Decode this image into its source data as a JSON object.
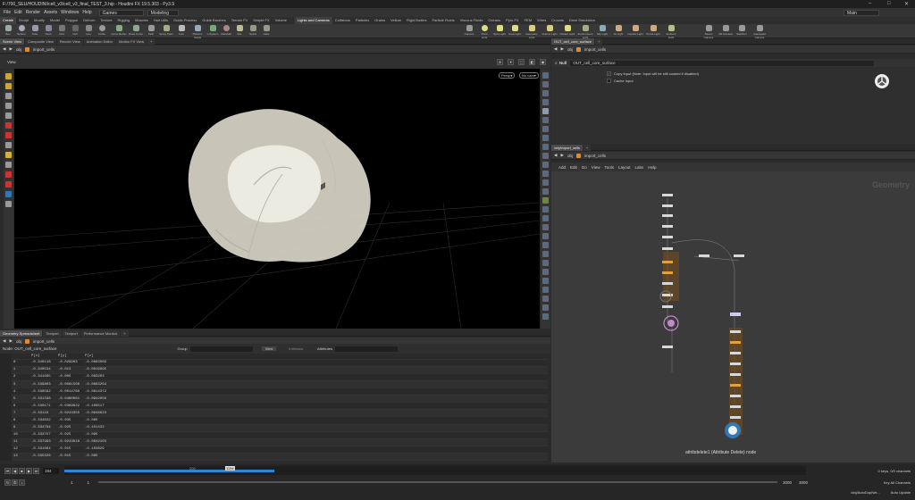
{
  "titlebar": {
    "text": "F:/700_SEU/HOUDINI/cell_v3/cell_v3_final_TEST_3.hip - Houdini FX 19.5.303 - Py3.9",
    "min": "–",
    "max": "□",
    "close": "✕"
  },
  "menubar": {
    "items": [
      "File",
      "Edit",
      "Render",
      "Assets",
      "Windows",
      "Help"
    ],
    "desktop": "Games",
    "mode": "Modeling",
    "main": "Main"
  },
  "shelf_left_tabs": [
    "Create",
    "Sculpt",
    "Modify",
    "Model",
    "Polygon",
    "Deform",
    "Texture",
    "Rigging",
    "Muscles",
    "Hair Utils",
    "Guide Process",
    "Guide Brushes",
    "Terrain FX",
    "Simple FX",
    "Volume"
  ],
  "shelf_right_tabs": [
    "Lights and Cameras",
    "Collisions",
    "Particles",
    "Grains",
    "Vellum",
    "Rigid Bodies",
    "Particle Fluids",
    "Viscous Fluids",
    "Oceans",
    "Pyro FX",
    "FEM",
    "Wires",
    "Crowds",
    "Drive Simulation"
  ],
  "left_tools": [
    "Box",
    "Sphere",
    "Tube",
    "Torus",
    "Grid",
    "Null",
    "Line",
    "Circle",
    "Curve Bezier",
    "Draw Curve",
    "Path",
    "Spray Paint",
    "Font",
    "Platonic Solids",
    "L-System",
    "Metaball",
    "File",
    "Spiral",
    "Helix"
  ],
  "right_tools": [
    "Camera",
    "Point Light",
    "Spot Light",
    "Area Light",
    "Geometry Light",
    "Volume Light",
    "Distant Light",
    "Environment Light",
    "Sky Light",
    "GI Light",
    "Caustic Light",
    "Portal Light",
    "Ambient Light",
    "Stereo Camera",
    "VR Camera",
    "Switcher",
    "Gamepad Camera"
  ],
  "left_tabs": [
    "Scene View",
    "Composite View",
    "Render View",
    "Animation Editor",
    "Motion FX View"
  ],
  "path": {
    "obj": "obj",
    "node": "import_cells"
  },
  "viewport": {
    "label": "View",
    "persp": "Persp▾",
    "cam": "No cam▾"
  },
  "param_tabs": [
    "OUT_cell_core_surface"
  ],
  "params": {
    "node_type": "Null",
    "node_name": "OUT_cell_core_surface",
    "opt1": "Copy Input (Note: Input will be still cooked if disabled)",
    "opt2": "Cache Input"
  },
  "net_tabs": [
    "/obj/import_cells"
  ],
  "net_menu": [
    "Add",
    "Edit",
    "Go",
    "View",
    "Tools",
    "Layout",
    "Labs",
    "Help"
  ],
  "net": {
    "context": "Geometry",
    "status": "attribdelete1 (Attribute Delete) node"
  },
  "bottom_tabs": [
    "Geometry Spreadsheet",
    "Textport",
    "Textport",
    "Performance Monitor"
  ],
  "sheet": {
    "node_label": "Node: OUT_cell_core_surface",
    "group": "Group",
    "view": "View",
    "intrinsics": "Intrinsics",
    "attributes": "Attributes",
    "headers": [
      "",
      "P[x]",
      "P[y]",
      "P[z]"
    ],
    "rows": [
      [
        "0",
        "-0.340118",
        "-0.029903",
        "-0.0683069"
      ],
      [
        "1",
        "-0.340534",
        "-0.013",
        "-0.0819995"
      ],
      [
        "2",
        "-0.341095",
        "-0.005",
        "-0.083203"
      ],
      [
        "3",
        "-0.339803",
        "-0.0081506",
        "-0.0663264"
      ],
      [
        "4",
        "-0.338592",
        "-0.0014768",
        "-0.0814372"
      ],
      [
        "5",
        "-0.331338",
        "-0.0460061",
        "-0.0942056"
      ],
      [
        "6",
        "-0.330171",
        "-0.0369922",
        "-0.109517"
      ],
      [
        "7",
        "-0.33143",
        "-0.0243355",
        "-0.0948623"
      ],
      [
        "8",
        "-0.334832",
        "-0.035",
        "-0.065"
      ],
      [
        "9",
        "-0.334784",
        "-0.025",
        "-0.101432"
      ],
      [
        "10",
        "-0.333757",
        "-0.025",
        "-0.095"
      ],
      [
        "11",
        "-0.337983",
        "-0.0243018",
        "-0.0842103"
      ],
      [
        "12",
        "-0.331664",
        "-0.015",
        "-0.103829"
      ],
      [
        "13",
        "-0.335326",
        "-0.015",
        "-0.085"
      ]
    ]
  },
  "timeline": {
    "frame": "194",
    "start": "1",
    "start2": "1",
    "end": "3000",
    "end2": "3000",
    "ticks": [
      "200",
      "1194"
    ],
    "keys": "0 keys, 0/0 channels",
    "keyall": "Key All Channels",
    "autoupdate": "Auto Update",
    "path": "/obj/AutoDopNet..."
  },
  "accent": "#2e87d6",
  "mesh_color": "#d9d6c8"
}
